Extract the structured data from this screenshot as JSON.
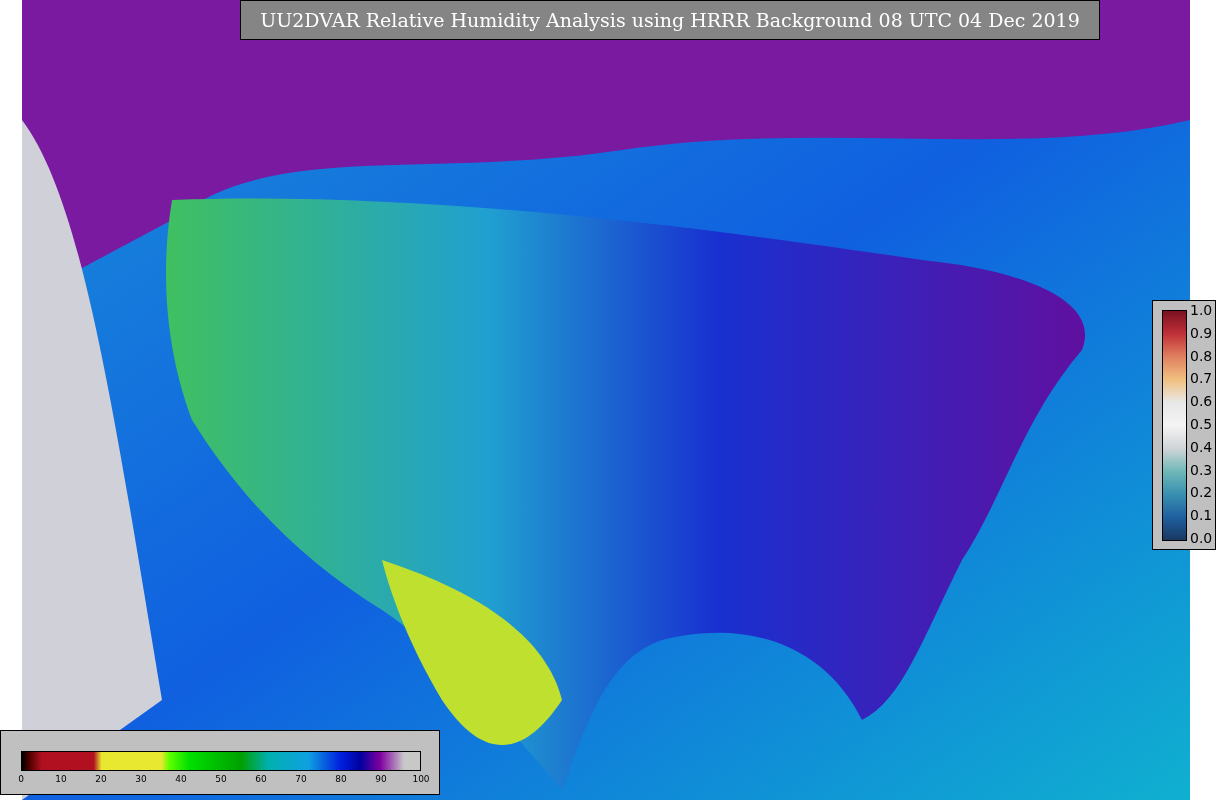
{
  "title": "UU2DVAR Relative Humidity Analysis using HRRR Background 08 UTC 04 Dec 2019",
  "humidity_scale": {
    "ticks": [
      "0",
      "10",
      "20",
      "30",
      "40",
      "50",
      "60",
      "70",
      "80",
      "90",
      "100"
    ]
  },
  "weight_scale": {
    "ticks": [
      "1.0",
      "0.9",
      "0.8",
      "0.7",
      "0.6",
      "0.5",
      "0.4",
      "0.3",
      "0.2",
      "0.1",
      "0.0"
    ]
  }
}
